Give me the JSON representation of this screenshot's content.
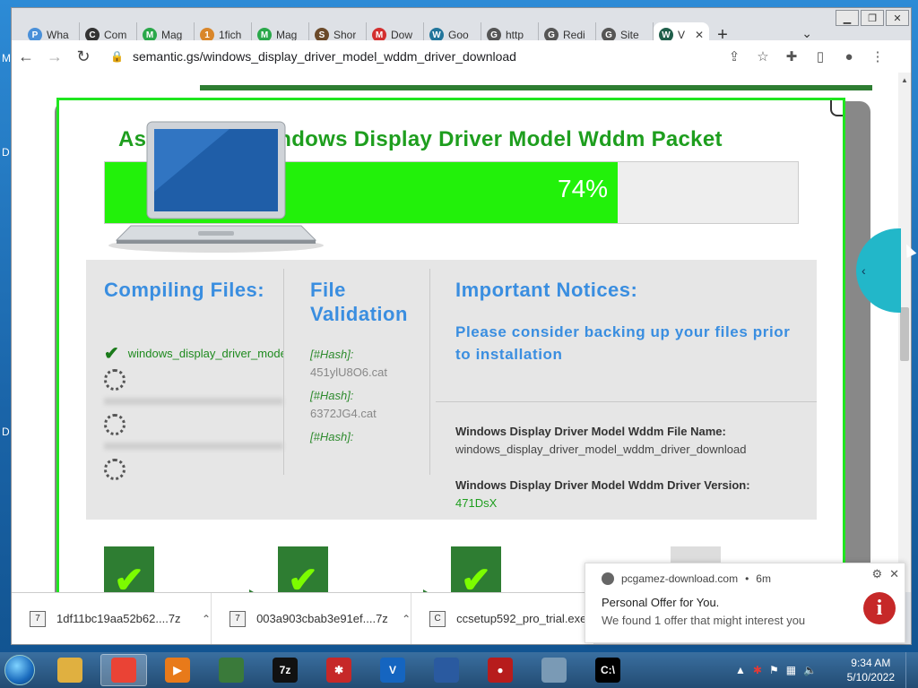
{
  "desktop": {
    "letters": [
      "M",
      "D",
      "D"
    ]
  },
  "browser": {
    "tabs": [
      {
        "title": "Wha",
        "icon_color": "#4a90d9",
        "icon": "P"
      },
      {
        "title": "Com",
        "icon_color": "#333333",
        "icon": "C"
      },
      {
        "title": "Mag",
        "icon_color": "#2aa84a",
        "icon": "M"
      },
      {
        "title": "1fich",
        "icon_color": "#d9862a",
        "icon": "1"
      },
      {
        "title": "Mag",
        "icon_color": "#2aa84a",
        "icon": "M"
      },
      {
        "title": "Shor",
        "icon_color": "#6b4a2a",
        "icon": "S"
      },
      {
        "title": "Dow",
        "icon_color": "#d32f2f",
        "icon": "M"
      },
      {
        "title": "Goo",
        "icon_color": "#21759b",
        "icon": "W"
      },
      {
        "title": "http",
        "icon_color": "#555555",
        "icon": "G"
      },
      {
        "title": "Redi",
        "icon_color": "#555555",
        "icon": "G"
      },
      {
        "title": "Site",
        "icon_color": "#555555",
        "icon": "G"
      },
      {
        "title": "V",
        "icon_color": "#1f5e4a",
        "icon": "W",
        "active": true
      }
    ],
    "new_tab": "+",
    "tab_search": "⌄",
    "address": "semantic.gs/windows_display_driver_model_wddm_driver_download"
  },
  "page": {
    "title_visible_left": "As",
    "title_visible_right": "indows Display Driver Model Wddm Packet",
    "progress": 0.74,
    "progress_label": "74%",
    "col1_heading": "Compiling Files:",
    "col2_heading": "File Validation",
    "col3_heading": "Important Notices:",
    "notice_text": "Please consider backing up your files prior to installation",
    "compiled_file": "windows_display_driver_model_wddm_driver_download",
    "hashes": [
      {
        "label": "[#Hash]:",
        "value": "451ylU8O6.cat"
      },
      {
        "label": "[#Hash]:",
        "value": "6372JG4.cat"
      },
      {
        "label": "[#Hash]:",
        "value": ""
      }
    ],
    "file_name_label": "Windows Display Driver Model Wddm File Name:",
    "file_name_value": "windows_display_driver_model_wddm_driver_download",
    "version_label": "Windows Display Driver Model Wddm Driver Version:",
    "version_value": "471DsX",
    "side_tab_glyph": "‹"
  },
  "downloads": [
    {
      "name": "1df11bc19aa52b62....7z",
      "icon": "7"
    },
    {
      "name": "003a903cbab3e91ef....7z",
      "icon": "7"
    },
    {
      "name": "ccsetup592_pro_trial.exe",
      "icon": "C"
    }
  ],
  "notification": {
    "source": "pcgamez-download.com",
    "age": "6m",
    "title": "Personal Offer for You.",
    "body": "We found 1 offer that might interest you",
    "badge": "i"
  },
  "taskbar": {
    "apps": [
      {
        "name": "explorer",
        "color": "#e0b040",
        "label": ""
      },
      {
        "name": "chrome",
        "color": "#ea4335",
        "label": "",
        "active": true
      },
      {
        "name": "media",
        "color": "#e87a1a",
        "label": "▶"
      },
      {
        "name": "taskmgr",
        "color": "#3a7a3a",
        "label": ""
      },
      {
        "name": "7zip",
        "color": "#111111",
        "label": "7z"
      },
      {
        "name": "app-red",
        "color": "#c62828",
        "label": "✱"
      },
      {
        "name": "vpn",
        "color": "#1565c0",
        "label": "V"
      },
      {
        "name": "image-tool",
        "color": "#2a5aa0",
        "label": ""
      },
      {
        "name": "recorder",
        "color": "#b71c1c",
        "label": "●"
      },
      {
        "name": "notes",
        "color": "#7a9ab5",
        "label": ""
      },
      {
        "name": "cmd",
        "color": "#000000",
        "label": "C:\\"
      }
    ],
    "time": "9:34 AM",
    "date": "5/10/2022"
  }
}
